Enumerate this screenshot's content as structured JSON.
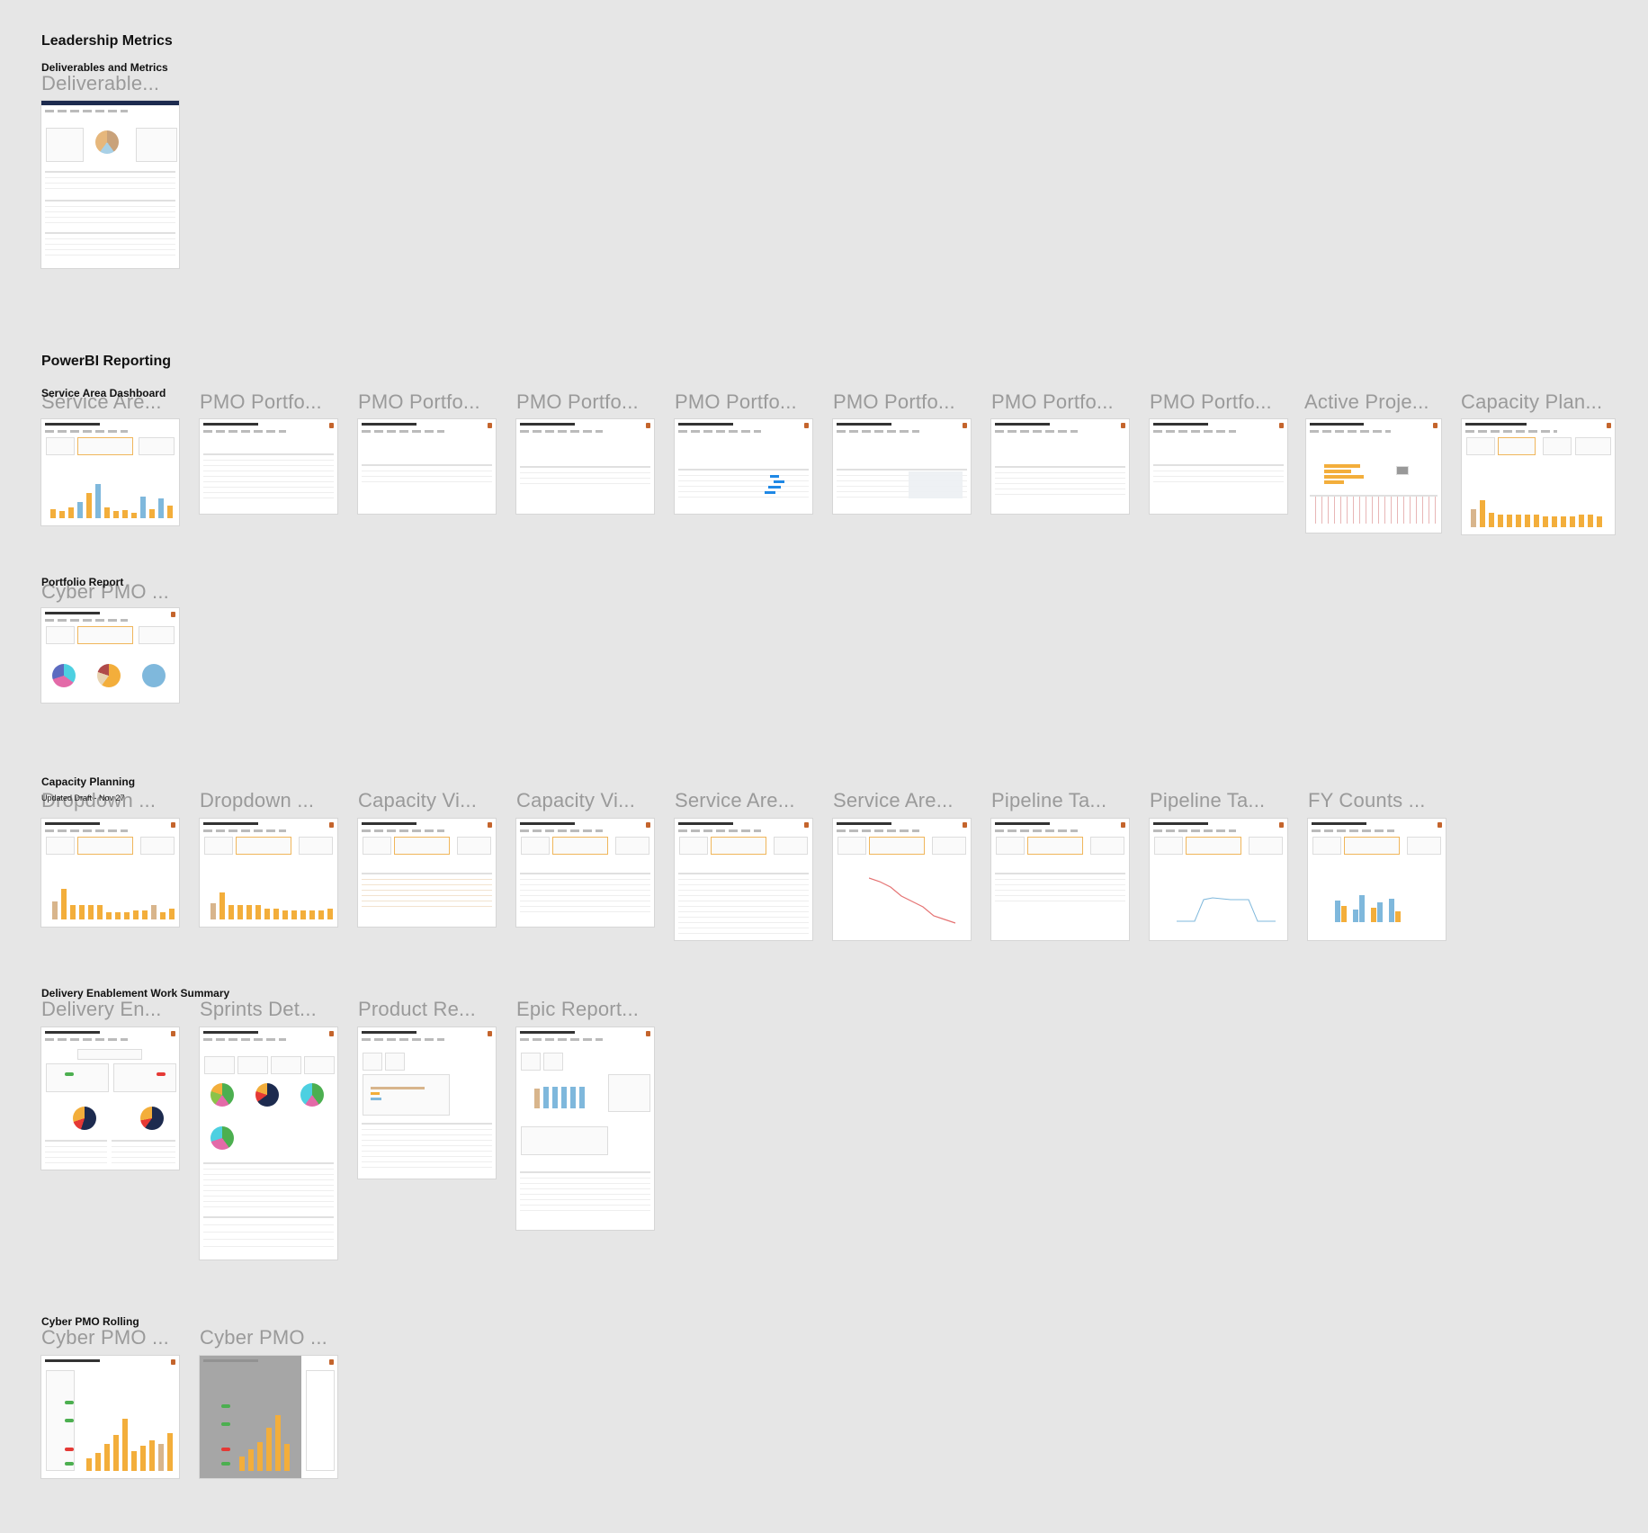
{
  "sections": {
    "leadership": {
      "title": "Leadership Metrics",
      "group": "Deliverables and Metrics",
      "frames": [
        "Deliverable..."
      ]
    },
    "powerbi": {
      "title": "PowerBI Reporting",
      "group": "Service Area Dashboard",
      "frames": [
        "Service Are...",
        "PMO Portfo...",
        "PMO Portfo...",
        "PMO Portfo...",
        "PMO Portfo...",
        "PMO Portfo...",
        "PMO Portfo...",
        "PMO Portfo...",
        "Active Proje...",
        "Capacity Plan..."
      ],
      "group2": "Portfolio Report",
      "frames2": [
        "Cyber PMO ..."
      ]
    },
    "capacity": {
      "title": "Capacity Planning",
      "subtitle": "Updated Draft - Nov 27",
      "frames": [
        "Dropdown ...",
        "Dropdown ...",
        "Capacity Vi...",
        "Capacity Vi...",
        "Service Are...",
        "Service Are...",
        "Pipeline Ta...",
        "Pipeline Ta...",
        "FY Counts ..."
      ]
    },
    "delivery": {
      "title": "Delivery Enablement Work Summary",
      "frames": [
        "Delivery En...",
        "Sprints Det...",
        "Product Re...",
        "Epic Report..."
      ]
    },
    "cyber": {
      "title": "Cyber PMO Rolling",
      "frames": [
        "Cyber PMO ...",
        "Cyber PMO ..."
      ]
    }
  },
  "colors": {
    "canvas": "#e6e6e6",
    "frame_name": "#9a9a9a",
    "accent_orange": "#f3ae3b",
    "accent_blue": "#7fb8dc"
  }
}
